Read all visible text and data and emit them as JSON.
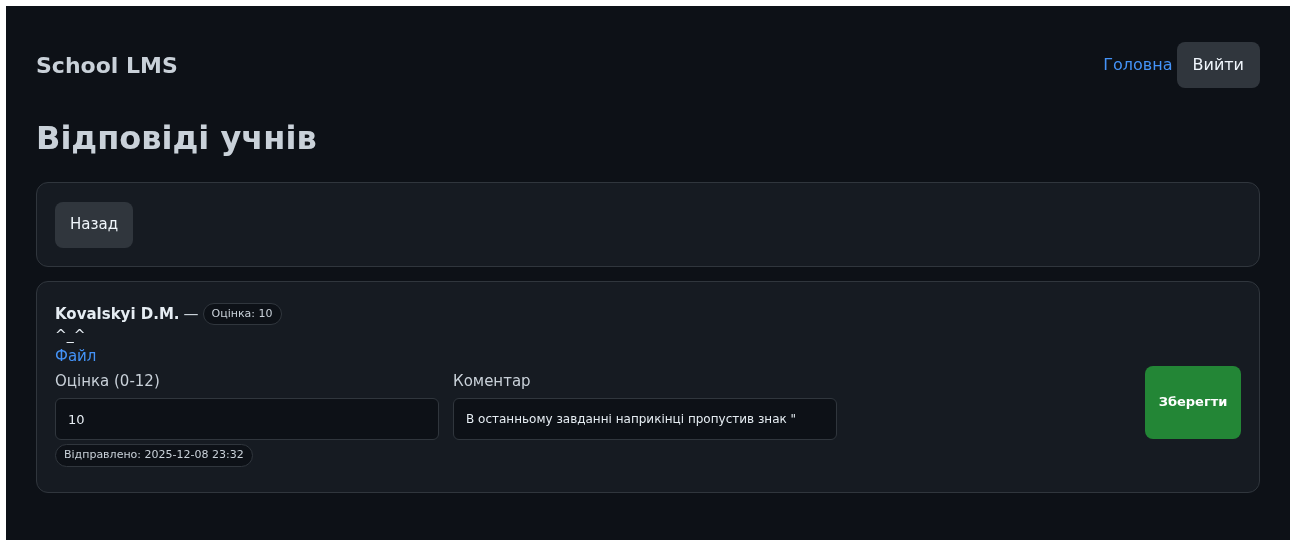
{
  "header": {
    "brand": "School LMS",
    "nav_link": "Головна",
    "logout_button": "Вийти"
  },
  "page_title": "Відповіді учнів",
  "back_button": "Назад",
  "submissions": [
    {
      "student": "Kovalskyi D.M.",
      "separator": "—",
      "grade_badge": "Оцінка: 10",
      "answer_text": "^_^",
      "file_link": "Файл",
      "grade_label": "Оцінка (0-12)",
      "grade_value": "10",
      "comment_label": "Коментар",
      "comment_value": "В останньому завданні наприкінці пропустив знак \"",
      "sent_badge": "Відправлено: 2025-12-08 23:32",
      "save_button": "Зберегти"
    }
  ]
}
